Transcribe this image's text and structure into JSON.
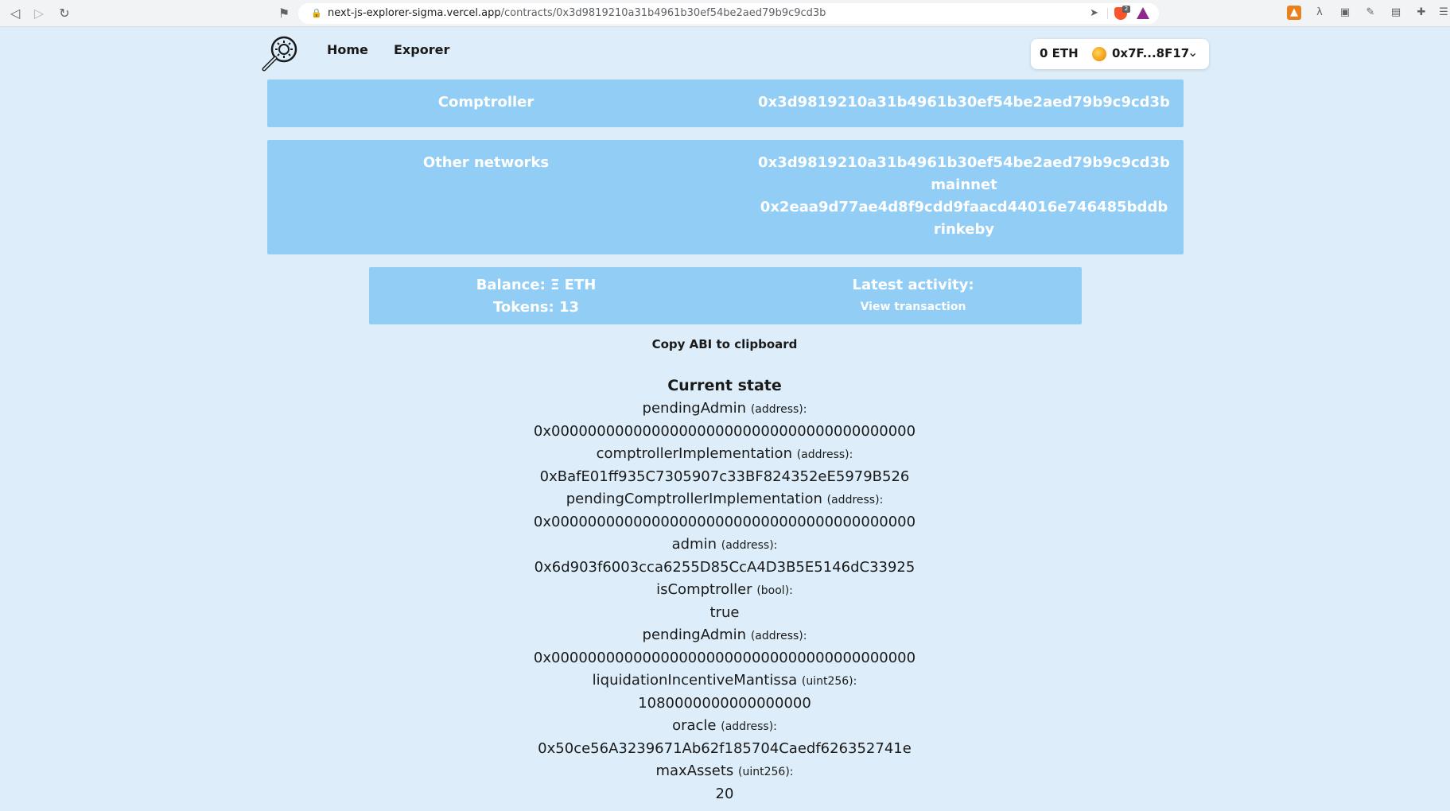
{
  "browser": {
    "url_host": "next-js-explorer-sigma.vercel.app",
    "url_path": "/contracts/0x3d9819210a31b4961b30ef54be2aed79b9c9cd3b",
    "brave_badge": "2"
  },
  "header": {
    "nav": [
      {
        "label": "Home"
      },
      {
        "label": "Exporer"
      }
    ],
    "wallet": {
      "balance": "0 ETH",
      "address": "0x7F...8F17"
    }
  },
  "contract": {
    "name": "Comptroller",
    "address": "0x3d9819210a31b4961b30ef54be2aed79b9c9cd3b"
  },
  "other_networks": {
    "label": "Other networks",
    "entries": [
      {
        "address": "0x3d9819210a31b4961b30ef54be2aed79b9c9cd3b",
        "network": "mainnet"
      },
      {
        "address": "0x2eaa9d77ae4d8f9cdd9faacd44016e746485bddb",
        "network": "rinkeby"
      }
    ]
  },
  "summary": {
    "balance": "Balance: Ξ ETH",
    "tokens": "Tokens: 13",
    "latest_activity_label": "Latest activity:",
    "view_transaction": "View transaction"
  },
  "copy_abi": "Copy ABI to clipboard",
  "current_state": {
    "title": "Current state",
    "items": [
      {
        "name": "pendingAdmin",
        "type": "(address):",
        "value": "0x0000000000000000000000000000000000000000"
      },
      {
        "name": "comptrollerImplementation",
        "type": "(address):",
        "value": "0xBafE01ff935C7305907c33BF824352eE5979B526"
      },
      {
        "name": "pendingComptrollerImplementation",
        "type": "(address):",
        "value": "0x0000000000000000000000000000000000000000"
      },
      {
        "name": "admin",
        "type": "(address):",
        "value": "0x6d903f6003cca6255D85CcA4D3B5E5146dC33925"
      },
      {
        "name": "isComptroller",
        "type": "(bool):",
        "value": "true"
      },
      {
        "name": "pendingAdmin",
        "type": "(address):",
        "value": "0x0000000000000000000000000000000000000000"
      },
      {
        "name": "liquidationIncentiveMantissa",
        "type": "(uint256):",
        "value": "1080000000000000000"
      },
      {
        "name": "oracle",
        "type": "(address):",
        "value": "0x50ce56A3239671Ab62f185704Caedf626352741e"
      },
      {
        "name": "maxAssets",
        "type": "(uint256):",
        "value": "20"
      }
    ]
  }
}
